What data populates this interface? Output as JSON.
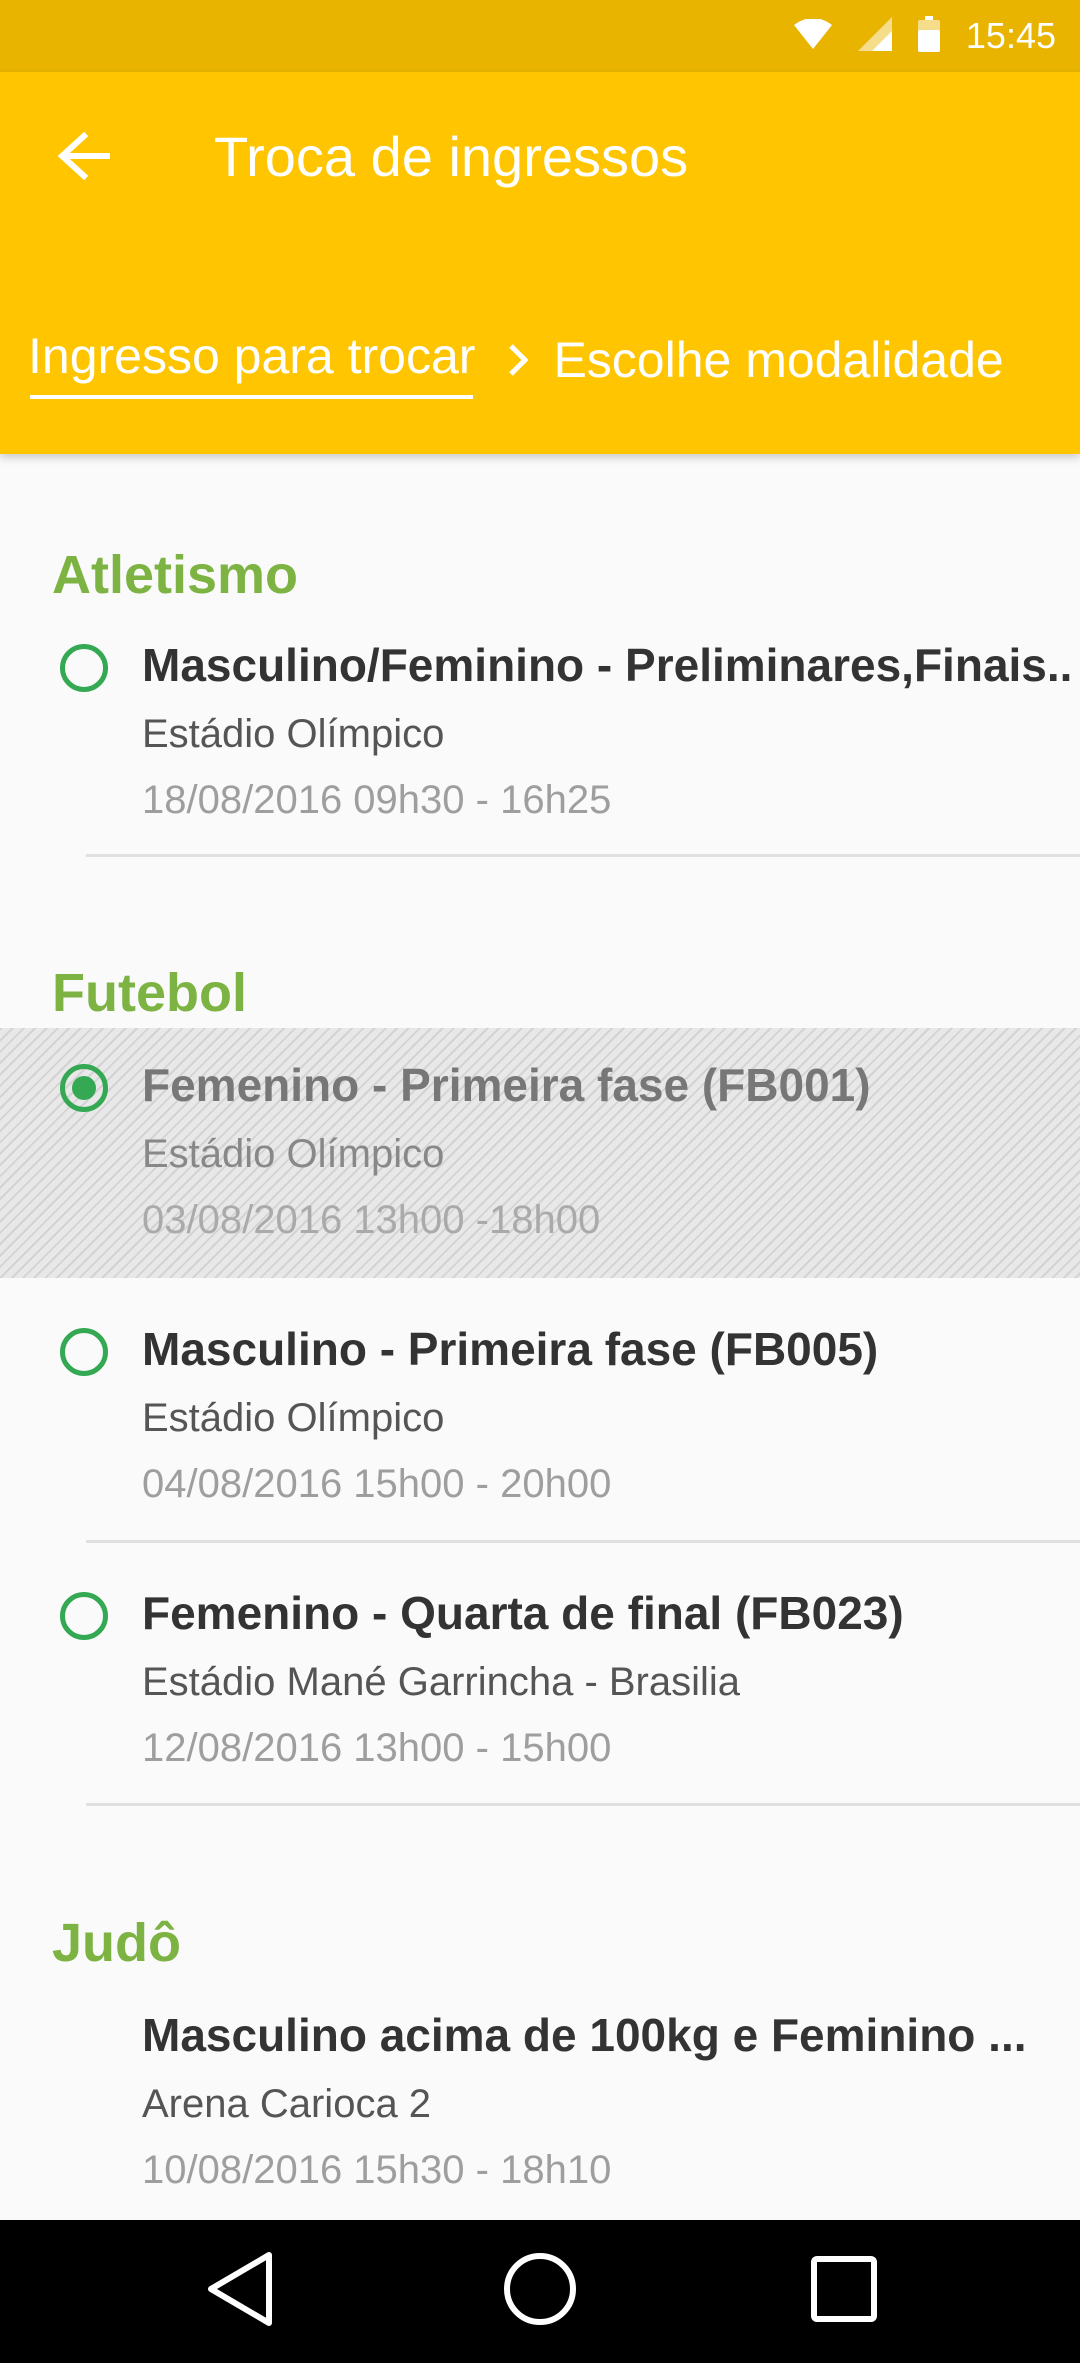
{
  "status_bar": {
    "time": "15:45"
  },
  "app_bar": {
    "title": "Troca de ingressos",
    "steps": [
      {
        "label": "Ingresso para trocar",
        "active": true
      },
      {
        "label": "Escolhe modalidade",
        "active": false
      }
    ]
  },
  "sections": [
    {
      "name": "Atletismo",
      "events": [
        {
          "title": "Masculino/Feminino - Preliminares,Finais..",
          "venue": "Estádio Olímpico",
          "date": "18/08/2016 09h30 - 16h25",
          "selected": false
        }
      ]
    },
    {
      "name": "Futebol",
      "events": [
        {
          "title": "Femenino - Primeira fase (FB001)",
          "venue": "Estádio Olímpico",
          "date": "03/08/2016 13h00 -18h00",
          "selected": true
        },
        {
          "title": "Masculino - Primeira fase (FB005)",
          "venue": "Estádio Olímpico",
          "date": "04/08/2016 15h00 - 20h00",
          "selected": false
        },
        {
          "title": "Femenino - Quarta de final (FB023)",
          "venue": "Estádio Mané Garrincha - Brasilia",
          "date": "12/08/2016 13h00 - 15h00",
          "selected": false
        }
      ]
    },
    {
      "name": "Judô",
      "events": [
        {
          "title": "Masculino acima de 100kg e Feminino ...",
          "venue": "Arena Carioca 2",
          "date": "10/08/2016 15h30 - 18h10",
          "selected": false
        }
      ]
    }
  ],
  "colors": {
    "status_bar": "#e8b400",
    "app_bar": "#ffc500",
    "section_title": "#7cb342",
    "radio": "#34a853"
  },
  "icons": [
    "wifi-icon",
    "signal-icon",
    "battery-icon",
    "back-arrow-icon",
    "chevron-right-icon",
    "nav-back-icon",
    "nav-home-icon",
    "nav-recents-icon"
  ]
}
